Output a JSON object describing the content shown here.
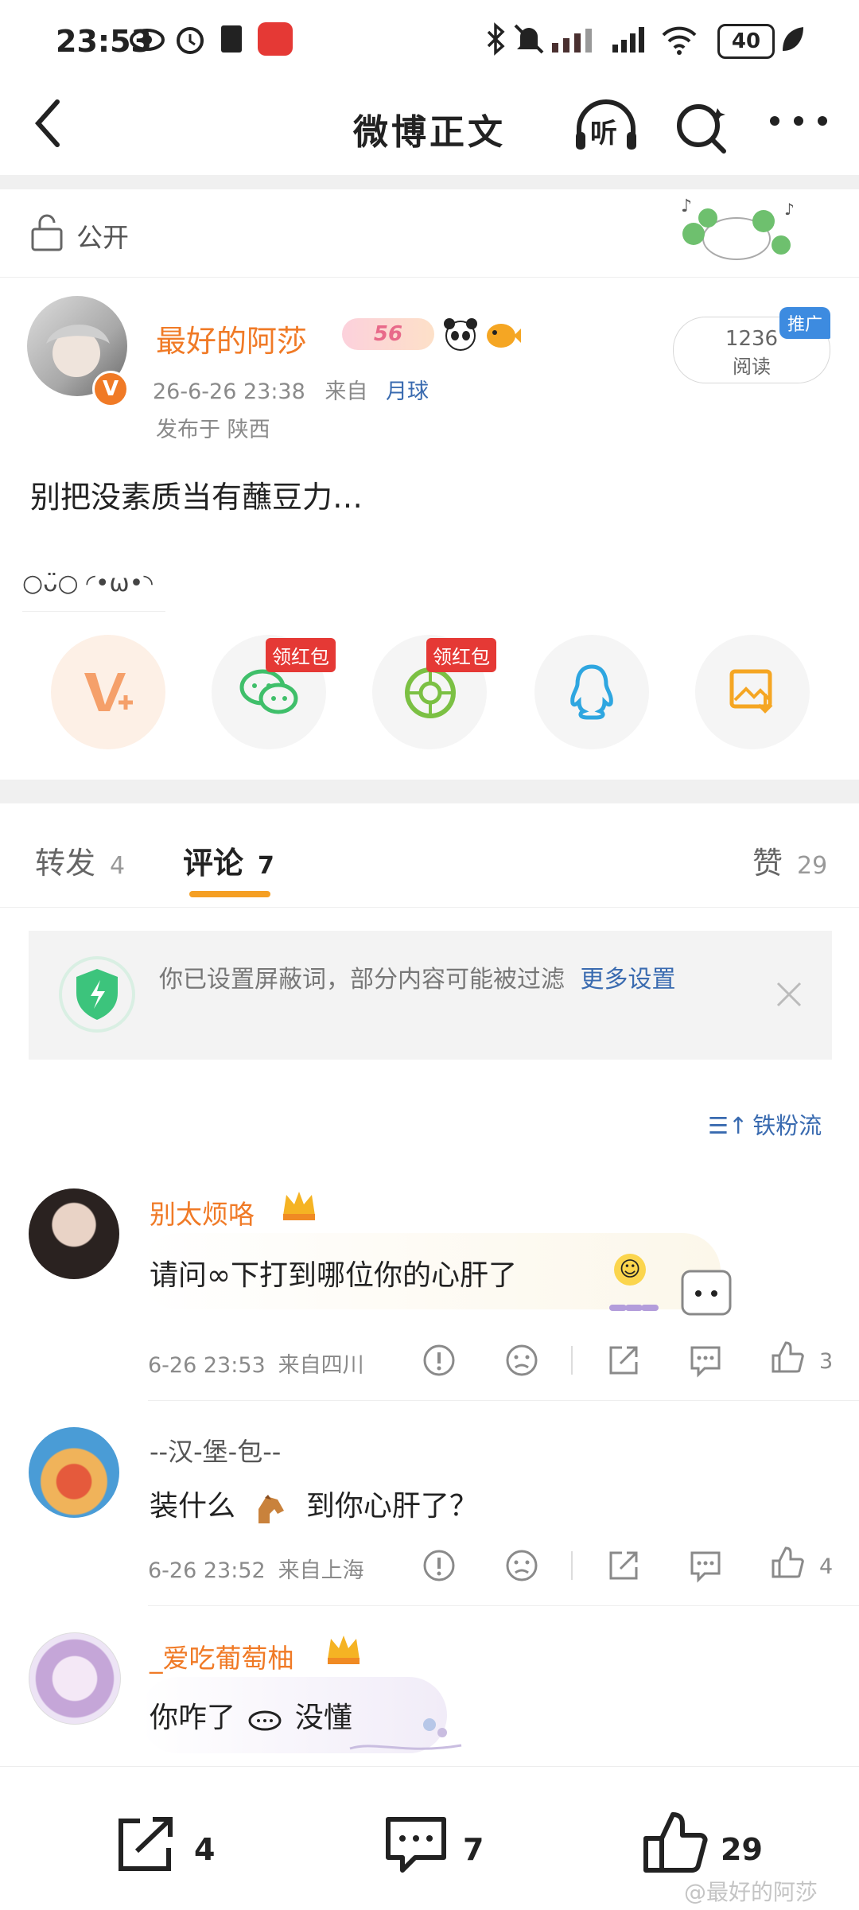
{
  "status_bar": {
    "time": "23:53",
    "battery": "40"
  },
  "header": {
    "title": "微博正文",
    "listen_label": "听"
  },
  "visibility": {
    "label": "公开"
  },
  "post": {
    "author": "最好的阿莎",
    "level_badge": "56",
    "date": "26-6-26 23:38",
    "source_prefix": "来自",
    "source": "月球",
    "location": "发布于 陕西",
    "read_count": "1236",
    "read_label": "阅读",
    "promo_badge": "推广",
    "content": "别把没素质当有蘸豆力…",
    "kaomoji": "○ᴗ̈○ ◜•ω•◝"
  },
  "share": {
    "red_packet_label_1": "领红包",
    "red_packet_label_2": "领红包"
  },
  "tabs": {
    "repost": "转发",
    "repost_count": "4",
    "comment": "评论",
    "comment_count": "7",
    "like": "赞",
    "like_count": "29"
  },
  "notice": {
    "text": "你已设置屏蔽词，部分内容可能被过滤",
    "link": "更多设置"
  },
  "sort": {
    "label": "铁粉流"
  },
  "comments": [
    {
      "name": "别太烦咯",
      "text": "请问∞下打到哪位你的心肝了",
      "time": "6-26 23:53",
      "source": "来自四川",
      "likes": "3"
    },
    {
      "name": "--汉-堡-包--",
      "text": "装什么",
      "text2": "到你心肝了？",
      "time": "6-26 23:52",
      "source": "来自上海",
      "likes": "4"
    },
    {
      "name": "_爱吃葡萄柚",
      "text": "你咋了",
      "text2": "没懂"
    }
  ],
  "bottom_bar": {
    "repost_count": "4",
    "comment_count": "7",
    "like_count": "29",
    "watermark": "@最好的阿莎"
  },
  "colors": {
    "accent_orange": "#f07a26",
    "link_blue": "#3a6bb0",
    "badge_red": "#e53935"
  }
}
